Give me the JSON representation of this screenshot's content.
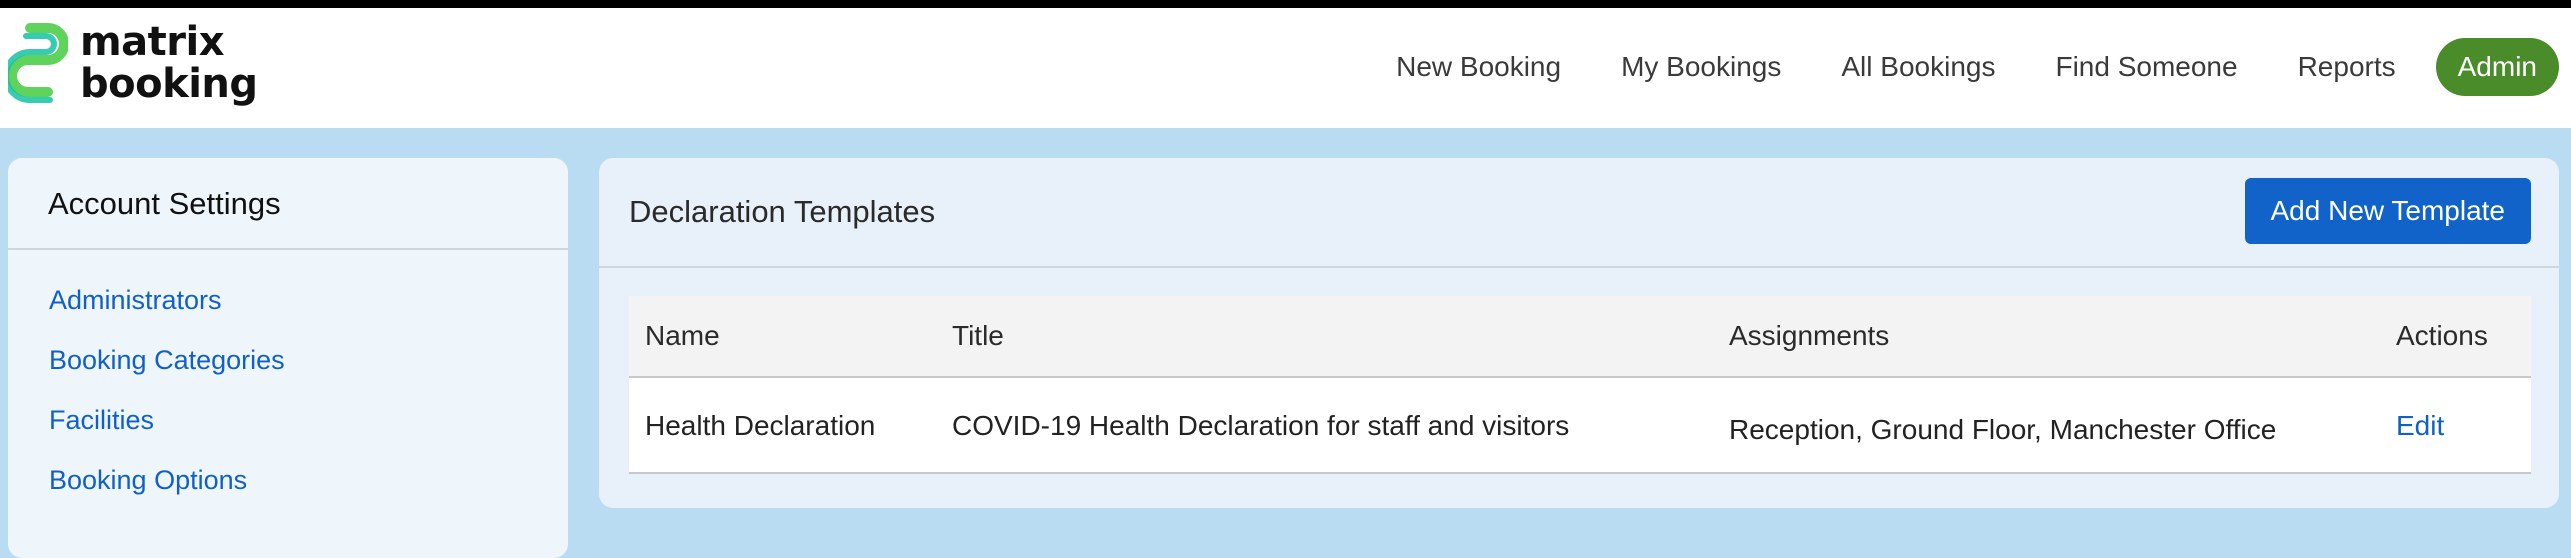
{
  "brand": {
    "line1": "matrix",
    "line2": "booking",
    "colors": {
      "logo_green": "#5fd35c",
      "logo_teal": "#14c3a4",
      "admin_green": "#4a8c2a",
      "primary_blue": "#1163c9"
    }
  },
  "nav": {
    "items": [
      "New Booking",
      "My Bookings",
      "All Bookings",
      "Find Someone",
      "Reports"
    ],
    "admin_label": "Admin"
  },
  "sidebar": {
    "title": "Account Settings",
    "links": [
      "Administrators",
      "Booking Categories",
      "Facilities",
      "Booking Options"
    ]
  },
  "main": {
    "title": "Declaration Templates",
    "add_button": "Add New Template",
    "table": {
      "headers": {
        "name": "Name",
        "title": "Title",
        "assignments": "Assignments",
        "actions": "Actions"
      },
      "rows": [
        {
          "name": "Health Declaration",
          "title": "COVID-19 Health Declaration for staff and visitors",
          "assignments": "Reception, Ground Floor, Manchester Office",
          "action": "Edit"
        }
      ]
    }
  }
}
